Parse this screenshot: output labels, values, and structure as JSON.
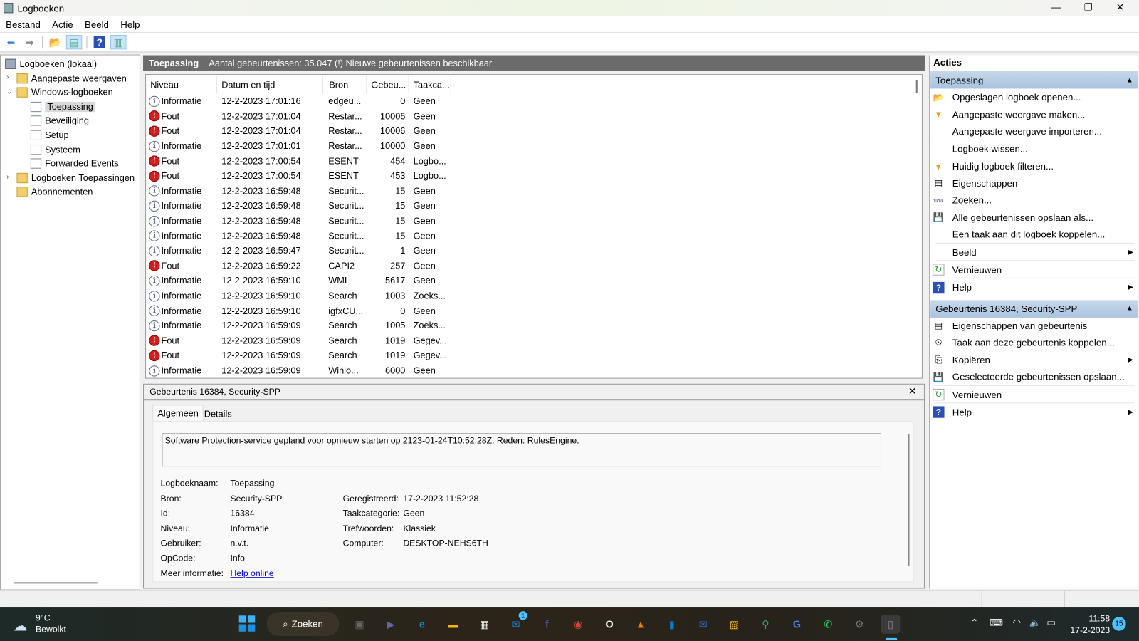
{
  "window": {
    "title": "Logboeken",
    "minimize": "—",
    "maximize": "❐",
    "close": "✕"
  },
  "menu": [
    "Bestand",
    "Actie",
    "Beeld",
    "Help"
  ],
  "toolbar": [
    {
      "icon": "back-arrow-icon",
      "g": "⬅",
      "c": "#2f7fd8"
    },
    {
      "icon": "forward-arrow-icon",
      "g": "➡",
      "c": "#888"
    },
    {
      "icon": "up-folder-icon",
      "g": "📂",
      "c": "#d8a300"
    },
    {
      "icon": "show-hide-tree-icon",
      "g": "▤",
      "c": "#4a8"
    },
    {
      "icon": "help-icon",
      "g": "?",
      "c": "#fff"
    },
    {
      "icon": "show-hide-actions-icon",
      "g": "▥",
      "c": "#4a8"
    }
  ],
  "tree": {
    "root": "Logboeken (lokaal)",
    "items": [
      {
        "label": "Aangepaste weergaven",
        "level": 1,
        "expander": "›"
      },
      {
        "label": "Windows-logboeken",
        "level": 1,
        "expander": "⌄"
      },
      {
        "label": "Toepassing",
        "level": 2,
        "selected": true
      },
      {
        "label": "Beveiliging",
        "level": 2
      },
      {
        "label": "Setup",
        "level": 2
      },
      {
        "label": "Systeem",
        "level": 2
      },
      {
        "label": "Forwarded Events",
        "level": 2
      },
      {
        "label": "Logboeken Toepassingen",
        "level": 1,
        "expander": "›"
      },
      {
        "label": "Abonnementen",
        "level": 1
      }
    ]
  },
  "center": {
    "title": "Toepassing",
    "summary": "Aantal gebeurtenissen: 35.047 (!) Nieuwe gebeurtenissen beschikbaar"
  },
  "grid": {
    "columns": [
      "Niveau",
      "Datum en tijd",
      "Bron",
      "Gebeu...",
      "Taakca..."
    ],
    "rows": [
      [
        "Informatie",
        "12-2-2023 17:01:16",
        "edgeu...",
        "0",
        "Geen"
      ],
      [
        "Fout",
        "12-2-2023 17:01:04",
        "Restar...",
        "10006",
        "Geen"
      ],
      [
        "Fout",
        "12-2-2023 17:01:04",
        "Restar...",
        "10006",
        "Geen"
      ],
      [
        "Informatie",
        "12-2-2023 17:01:01",
        "Restar...",
        "10000",
        "Geen"
      ],
      [
        "Fout",
        "12-2-2023 17:00:54",
        "ESENT",
        "454",
        "Logbo..."
      ],
      [
        "Fout",
        "12-2-2023 17:00:54",
        "ESENT",
        "453",
        "Logbo..."
      ],
      [
        "Informatie",
        "12-2-2023 16:59:48",
        "Securit...",
        "15",
        "Geen"
      ],
      [
        "Informatie",
        "12-2-2023 16:59:48",
        "Securit...",
        "15",
        "Geen"
      ],
      [
        "Informatie",
        "12-2-2023 16:59:48",
        "Securit...",
        "15",
        "Geen"
      ],
      [
        "Informatie",
        "12-2-2023 16:59:48",
        "Securit...",
        "15",
        "Geen"
      ],
      [
        "Informatie",
        "12-2-2023 16:59:47",
        "Securit...",
        "1",
        "Geen"
      ],
      [
        "Fout",
        "12-2-2023 16:59:22",
        "CAPI2",
        "257",
        "Geen"
      ],
      [
        "Informatie",
        "12-2-2023 16:59:10",
        "WMI",
        "5617",
        "Geen"
      ],
      [
        "Informatie",
        "12-2-2023 16:59:10",
        "Search",
        "1003",
        "Zoeks..."
      ],
      [
        "Informatie",
        "12-2-2023 16:59:10",
        "igfxCU...",
        "0",
        "Geen"
      ],
      [
        "Informatie",
        "12-2-2023 16:59:09",
        "Search",
        "1005",
        "Zoeks..."
      ],
      [
        "Fout",
        "12-2-2023 16:59:09",
        "Search",
        "1019",
        "Gegev..."
      ],
      [
        "Fout",
        "12-2-2023 16:59:09",
        "Search",
        "1019",
        "Gegev..."
      ],
      [
        "Informatie",
        "12-2-2023 16:59:09",
        "Winlo...",
        "6000",
        "Geen"
      ]
    ]
  },
  "detail": {
    "title": "Gebeurtenis 16384, Security-SPP",
    "close": "✕",
    "tabs": [
      "Algemeen",
      "Details"
    ],
    "message": "Software Protection-service gepland voor opnieuw starten op 2123-01-24T10:52:28Z. Reden: RulesEngine.",
    "left": [
      [
        "Logboeknaam:",
        "Toepassing"
      ],
      [
        "Bron:",
        "Security-SPP"
      ],
      [
        "Id:",
        "16384"
      ],
      [
        "Niveau:",
        "Informatie"
      ],
      [
        "Gebruiker:",
        "n.v.t."
      ],
      [
        "OpCode:",
        "Info"
      ],
      [
        "Meer informatie:",
        "Help online"
      ]
    ],
    "right": [
      [
        "Geregistreerd:",
        "17-2-2023 11:52:28"
      ],
      [
        "Taakcategorie:",
        "Geen"
      ],
      [
        "Trefwoorden:",
        "Klassiek"
      ],
      [
        "Computer:",
        "DESKTOP-NEHS6TH"
      ]
    ]
  },
  "actions": {
    "title": "Acties",
    "sections": [
      {
        "header": "Toepassing",
        "items": [
          {
            "label": "Opgeslagen logboek openen...",
            "icon": "open-folder-icon",
            "g": "📂"
          },
          {
            "label": "Aangepaste weergave maken...",
            "icon": "filter-icon",
            "g": "▼"
          },
          {
            "label": "Aangepaste weergave importeren...",
            "icon": "",
            "g": "",
            "div": true
          },
          {
            "label": "Logboek wissen...",
            "icon": "",
            "g": ""
          },
          {
            "label": "Huidig logboek filteren...",
            "icon": "filter-icon",
            "g": "▼"
          },
          {
            "label": "Eigenschappen",
            "icon": "properties-icon",
            "g": "▤"
          },
          {
            "label": "Zoeken...",
            "icon": "binoculars-icon",
            "g": "👓"
          },
          {
            "label": "Alle gebeurtenissen opslaan als...",
            "icon": "save-icon",
            "g": "💾"
          },
          {
            "label": "Een taak aan dit logboek koppelen...",
            "icon": "",
            "g": "",
            "div": true
          },
          {
            "label": "Beeld",
            "icon": "",
            "g": "",
            "sub": true,
            "div": true
          },
          {
            "label": "Vernieuwen",
            "icon": "refresh-icon",
            "g": "↻",
            "div": true
          },
          {
            "label": "Help",
            "icon": "help-icon",
            "g": "?",
            "sub": true
          }
        ]
      },
      {
        "header": "Gebeurtenis 16384, Security-SPP",
        "items": [
          {
            "label": "Eigenschappen van gebeurtenis",
            "icon": "properties-icon",
            "g": "▤"
          },
          {
            "label": "Taak aan deze gebeurtenis koppelen...",
            "icon": "task-clock-icon",
            "g": "⏲"
          },
          {
            "label": "Kopiëren",
            "icon": "copy-icon",
            "g": "⎘",
            "sub": true
          },
          {
            "label": "Geselecteerde gebeurtenissen opslaan...",
            "icon": "save-icon",
            "g": "💾",
            "div": true
          },
          {
            "label": "Vernieuwen",
            "icon": "refresh-icon",
            "g": "↻",
            "div": true
          },
          {
            "label": "Help",
            "icon": "help-icon",
            "g": "?",
            "sub": true
          }
        ]
      }
    ]
  },
  "taskbar": {
    "weather": {
      "temp": "9°C",
      "condition": "Bewolkt"
    },
    "search": "Zoeken",
    "mail_badge": "1",
    "apps": [
      {
        "n": "task-view",
        "c": "#666",
        "g": "▣"
      },
      {
        "n": "teams",
        "c": "#6264a7",
        "g": "▶"
      },
      {
        "n": "edge",
        "c": "#0c8fc7",
        "g": "e"
      },
      {
        "n": "file-explorer",
        "c": "#f2b619",
        "g": "▬"
      },
      {
        "n": "microsoft-store",
        "c": "#eee",
        "g": "▦"
      },
      {
        "n": "mail",
        "c": "#1a82d9",
        "g": "✉"
      },
      {
        "n": "facebook",
        "c": "#3b5998",
        "g": "f"
      },
      {
        "n": "chrome",
        "c": "#db4437",
        "g": "◉"
      },
      {
        "n": "opera",
        "c": "#fff",
        "g": "O"
      },
      {
        "n": "vlc",
        "c": "#f08000",
        "g": "▲"
      },
      {
        "n": "app-blue",
        "c": "#0a78d4",
        "g": "▮"
      },
      {
        "n": "thunderbird",
        "c": "#2f66c8",
        "g": "✉"
      },
      {
        "n": "photos",
        "c": "#e8b020",
        "g": "▨"
      },
      {
        "n": "google-maps",
        "c": "#34a853",
        "g": "⚲"
      },
      {
        "n": "google-translate",
        "c": "#4285f4",
        "g": "G"
      },
      {
        "n": "whatsapp",
        "c": "#25d366",
        "g": "✆"
      },
      {
        "n": "settings",
        "c": "#777",
        "g": "⚙"
      },
      {
        "n": "event-viewer",
        "c": "#889",
        "g": "▯"
      }
    ],
    "clock": {
      "time": "11:58",
      "date": "17-2-2023"
    },
    "notifications": "15"
  }
}
